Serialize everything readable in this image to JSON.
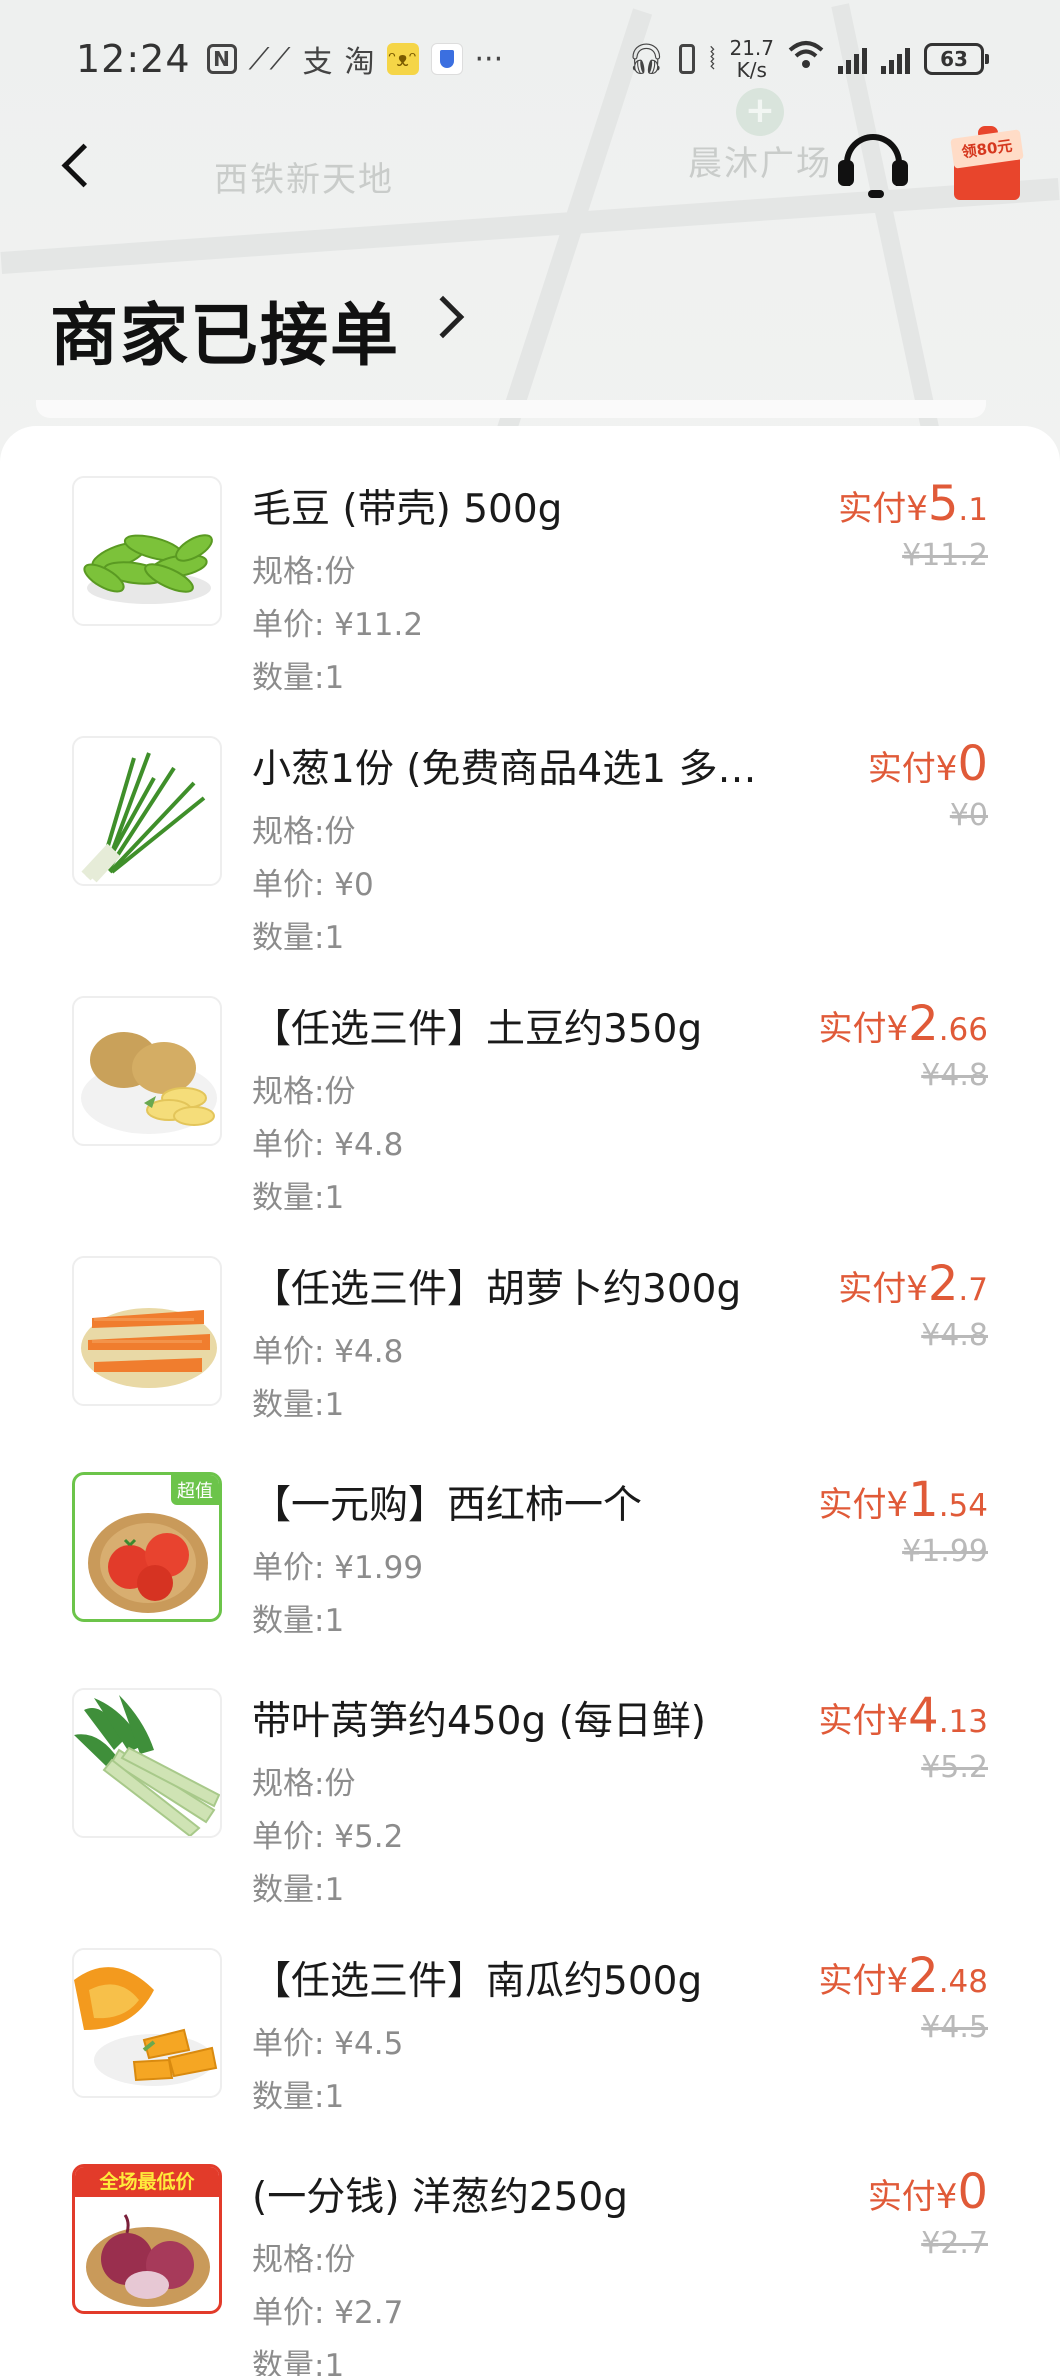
{
  "status_bar": {
    "time": "12:24",
    "net_speed_value": "21.7",
    "net_speed_unit": "K/s",
    "battery": "63",
    "app_icons": [
      "N",
      "支",
      "淘"
    ]
  },
  "map": {
    "label_left": "西铁新天地",
    "label_right": "晨沐广场"
  },
  "header": {
    "coupon_text": "领80元"
  },
  "page_title": "商家已接单",
  "labels": {
    "paid_prefix": "实付¥",
    "spec_prefix": "规格:",
    "unit_price_prefix": "单价: ¥",
    "qty_prefix": "数量:"
  },
  "items": [
    {
      "name": "毛豆 (带壳) 500g",
      "spec": "规格:份",
      "unit_price": "单价: ¥11.2",
      "qty": "数量:1",
      "paid_prefix": "实付¥",
      "paid_int": "5",
      "paid_dec": ".1",
      "original": "¥11.2",
      "image": "edamame"
    },
    {
      "name": "小葱1份 (免费商品4选1 多…",
      "spec": "规格:份",
      "unit_price": "单价: ¥0",
      "qty": "数量:1",
      "paid_prefix": "实付¥",
      "paid_int": "0",
      "paid_dec": "",
      "original": "¥0",
      "image": "scallion"
    },
    {
      "name": "【任选三件】土豆约350g",
      "spec": "规格:份",
      "unit_price": "单价: ¥4.8",
      "qty": "数量:1",
      "paid_prefix": "实付¥",
      "paid_int": "2",
      "paid_dec": ".66",
      "original": "¥4.8",
      "image": "potato"
    },
    {
      "name": "【任选三件】胡萝卜约300g",
      "spec": "",
      "unit_price": "单价: ¥4.8",
      "qty": "数量:1",
      "paid_prefix": "实付¥",
      "paid_int": "2",
      "paid_dec": ".7",
      "original": "¥4.8",
      "image": "carrot"
    },
    {
      "name": "【一元购】西红柿一个",
      "spec": "",
      "unit_price": "单价: ¥1.99",
      "qty": "数量:1",
      "paid_prefix": "实付¥",
      "paid_int": "1",
      "paid_dec": ".54",
      "original": "¥1.99",
      "image": "tomato",
      "badge": "超值"
    },
    {
      "name": "带叶莴笋约450g (每日鲜)",
      "spec": "规格:份",
      "unit_price": "单价: ¥5.2",
      "qty": "数量:1",
      "paid_prefix": "实付¥",
      "paid_int": "4",
      "paid_dec": ".13",
      "original": "¥5.2",
      "image": "lettuce"
    },
    {
      "name": "【任选三件】南瓜约500g",
      "spec": "",
      "unit_price": "单价: ¥4.5",
      "qty": "数量:1",
      "paid_prefix": "实付¥",
      "paid_int": "2",
      "paid_dec": ".48",
      "original": "¥4.5",
      "image": "pumpkin"
    },
    {
      "name": "(一分钱) 洋葱约250g",
      "spec": "规格:份",
      "unit_price": "单价: ¥2.7",
      "qty": "数量:1",
      "paid_prefix": "实付¥",
      "paid_int": "0",
      "paid_dec": "",
      "original": "¥2.7",
      "image": "onion",
      "badge": "全场最低价"
    }
  ]
}
